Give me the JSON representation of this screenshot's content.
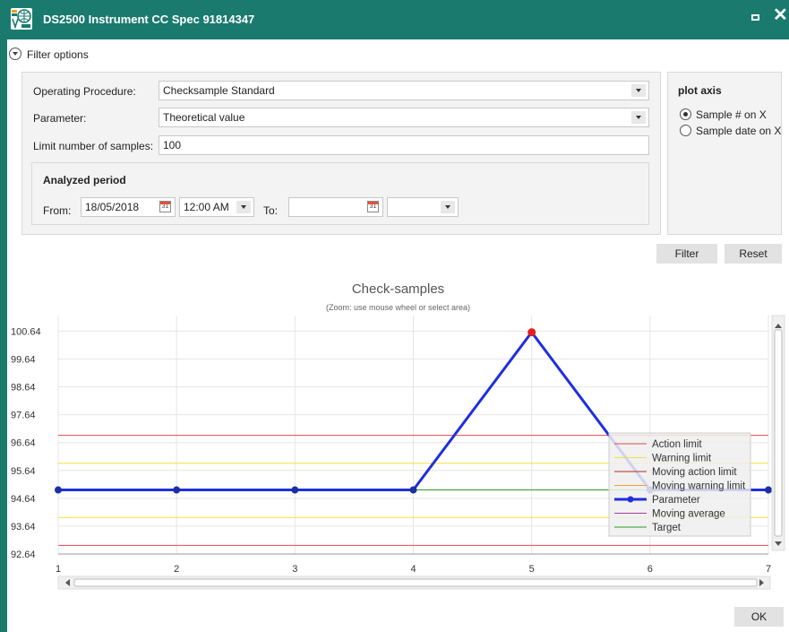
{
  "window": {
    "title": "DS2500 Instrument CC Spec 91814347",
    "accent_color": "#1a7a6e",
    "app_icon": "vitris-logo-icon"
  },
  "filter": {
    "toggle_label": "Filter options",
    "operating_procedure_label": "Operating Procedure:",
    "operating_procedure_value": "Checksample Standard",
    "parameter_label": "Parameter:",
    "parameter_value": "Theoretical value",
    "limit_label": "Limit number of samples:",
    "limit_value": "100",
    "period_title": "Analyzed period",
    "from_label": "From:",
    "from_date": "18/05/2018",
    "from_time": "12:00 AM",
    "to_label": "To:",
    "to_date": "",
    "to_time": "",
    "calendar_icon_text": "31"
  },
  "plot_axis": {
    "title": "plot axis",
    "options": [
      {
        "label": "Sample # on X",
        "selected": true
      },
      {
        "label": "Sample date on X",
        "selected": false
      }
    ]
  },
  "buttons": {
    "filter": "Filter",
    "reset": "Reset",
    "ok": "OK"
  },
  "chart_data": {
    "type": "line",
    "title": "Check-samples",
    "subtitle": "(Zoom: use mouse wheel or select area)",
    "x": [
      1,
      2,
      3,
      4,
      5,
      6,
      7
    ],
    "x_ticks": [
      "1",
      "2",
      "3",
      "4",
      "5",
      "6",
      "7"
    ],
    "y_ticks": [
      "100.64",
      "99.64",
      "98.64",
      "97.64",
      "96.64",
      "95.64",
      "94.64",
      "93.64",
      "92.64"
    ],
    "ylim": [
      92.64,
      101.2
    ],
    "series": [
      {
        "name": "Parameter",
        "color": "#1f2ee0",
        "values": [
          94.94,
          94.94,
          94.94,
          94.94,
          100.6,
          94.94,
          94.94
        ],
        "highlight_index": 4,
        "highlight_color": "#e02020"
      },
      {
        "name": "Target",
        "color": "#2a9a2a",
        "constant": 94.94
      },
      {
        "name": "Action limit",
        "color": "#e04a4a",
        "constant_upper": 96.9,
        "constant_lower": 92.95
      },
      {
        "name": "Warning limit",
        "color": "#f0e040",
        "constant_upper": 95.9,
        "constant_lower": 93.95
      }
    ],
    "legend": [
      "Action limit",
      "Warning limit",
      "Moving action limit",
      "Moving warning limit",
      "Parameter",
      "Moving average",
      "Target"
    ],
    "legend_colors": [
      "#e04a4a",
      "#f0e040",
      "#b03020",
      "#f0a030",
      "#1f2ee0",
      "#a040a0",
      "#2a9a2a"
    ],
    "legend_placement": "bottom-right",
    "grid": true
  }
}
